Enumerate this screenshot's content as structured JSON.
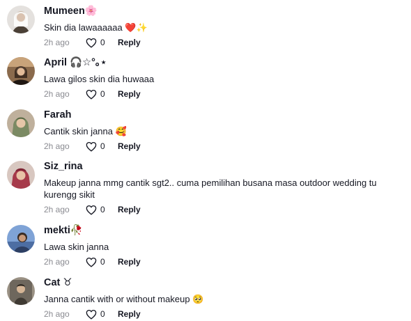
{
  "comments": [
    {
      "username": "Mumeen🌸",
      "text": "Skin dia lawaaaaaa ❤️✨",
      "time": "2h ago",
      "likes": "0",
      "reply_label": "Reply",
      "avatar_colors": [
        "#d9d6d3",
        "#4a4036"
      ]
    },
    {
      "username": "April 🎧☆°｡⋆",
      "text": "Lawa gilos skin dia huwaaa",
      "time": "2h ago",
      "likes": "0",
      "reply_label": "Reply",
      "avatar_colors": [
        "#7a5a3c",
        "#3a2a1e"
      ]
    },
    {
      "username": "Farah",
      "text": "Cantik skin janna 🥰",
      "time": "2h ago",
      "likes": "0",
      "reply_label": "Reply",
      "avatar_colors": [
        "#c9b9a6",
        "#6b7a5a"
      ]
    },
    {
      "username": "Siz_rina",
      "text": "Makeup janna mmg cantik sgt2.. cuma pemilihan busana masa outdoor wedding tu kurengg sikit",
      "time": "2h ago",
      "likes": "0",
      "reply_label": "Reply",
      "avatar_colors": [
        "#a63a4a",
        "#5e1c28"
      ]
    },
    {
      "username": "mekti🥀",
      "text": "Lawa skin janna",
      "time": "2h ago",
      "likes": "0",
      "reply_label": "Reply",
      "avatar_colors": [
        "#6a8cc4",
        "#2d3f63"
      ]
    },
    {
      "username": "Cat ♉",
      "text": "Janna cantik with or without makeup 🥺",
      "time": "2h ago",
      "likes": "0",
      "reply_label": "Reply",
      "avatar_colors": [
        "#8c8478",
        "#3f3a33"
      ]
    }
  ]
}
